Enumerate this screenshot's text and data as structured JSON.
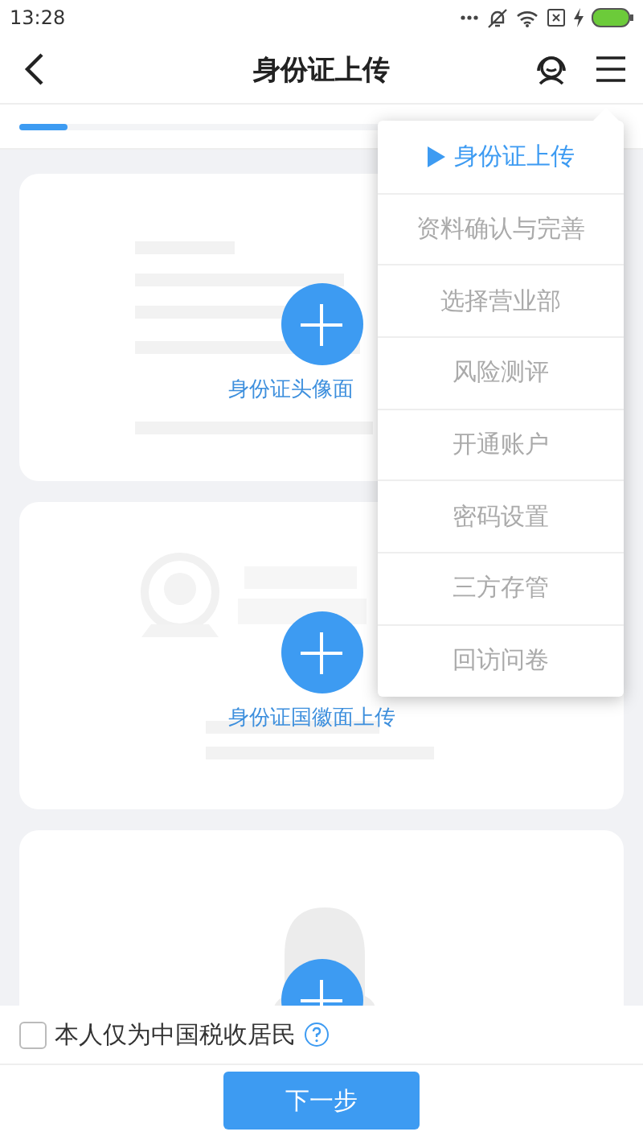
{
  "status_bar": {
    "time": "13:28"
  },
  "header": {
    "title": "身份证上传"
  },
  "progress": {
    "level": 0.08
  },
  "cards": [
    {
      "kind": "document",
      "label": "身份证头像面"
    },
    {
      "kind": "emblem",
      "label": "身份证国徽面上传"
    },
    {
      "kind": "portrait"
    }
  ],
  "menu": {
    "items": [
      {
        "label": "身份证上传",
        "selected": true
      },
      {
        "label": "资料确认与完善",
        "selected": false
      },
      {
        "label": "选择营业部",
        "selected": false
      },
      {
        "label": "风险测评",
        "selected": false
      },
      {
        "label": "开通账户",
        "selected": false
      },
      {
        "label": "密码设置",
        "selected": false
      },
      {
        "label": "三方存管",
        "selected": false
      },
      {
        "label": "回访问卷",
        "selected": false
      }
    ]
  },
  "tax_resident": {
    "label": "本人仅为中国税收居民",
    "checked": false
  },
  "next_button": {
    "label": "下一步"
  }
}
